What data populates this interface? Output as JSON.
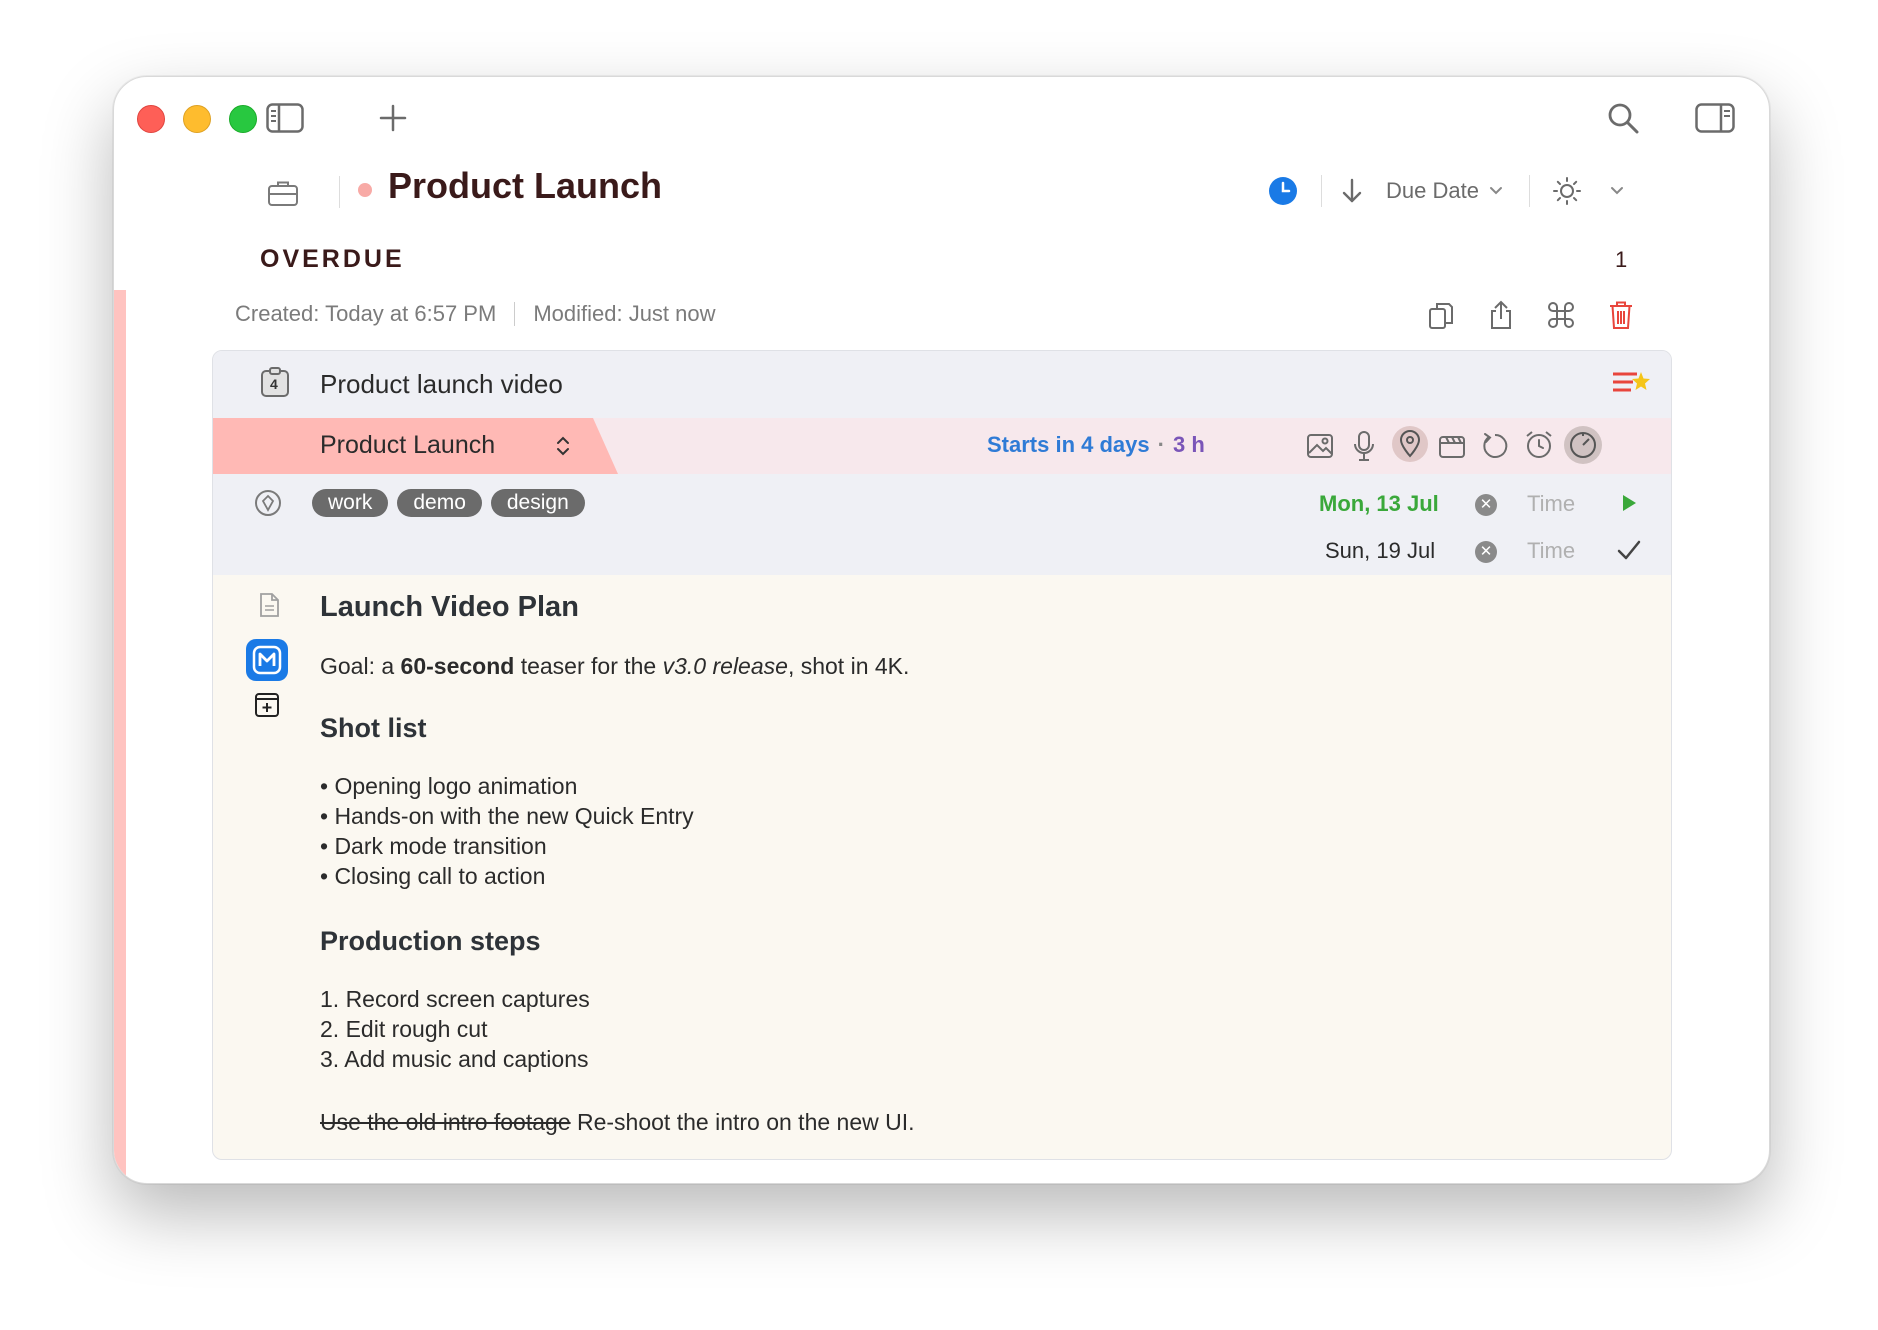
{
  "header": {
    "title": "Product Launch",
    "sort_label": "Due Date"
  },
  "section": {
    "title": "OVERDUE",
    "count": "1"
  },
  "meta": {
    "created": "Created: Today at 6:57 PM",
    "modified": "Modified: Just now"
  },
  "task": {
    "checklist_count": "4",
    "title": "Product launch video",
    "project": "Product Launch",
    "starts": "Starts in 4 days",
    "separator": "·",
    "duration": "3 h",
    "tags": [
      "work",
      "demo",
      "design"
    ],
    "start_date": "Mon, 13 Jul",
    "due_date": "Sun, 19 Jul",
    "time_placeholder": "Time"
  },
  "notes": {
    "heading": "Launch Video Plan",
    "goal_prefix": "Goal: a ",
    "goal_bold": "60-second",
    "goal_mid": " teaser for the ",
    "goal_italic": "v3.0 release",
    "goal_suffix": ", shot in 4K.",
    "shot_heading": "Shot list",
    "shots": [
      "• Opening logo animation",
      "• Hands-on with the new Quick Entry",
      "• Dark mode transition",
      "• Closing call to action"
    ],
    "steps_heading": "Production steps",
    "steps": [
      "1. Record screen captures",
      "2. Edit rough cut",
      "3. Add music and captions"
    ],
    "strike_text": "Use the old intro footage",
    "final_text": " Re-shoot the intro on the new UI."
  },
  "colors": {
    "accent_red": "#fe5f57",
    "project_pill": "#ffb9b5",
    "starts_blue": "#2f7bd6",
    "duration_purple": "#7a55b8",
    "start_green": "#3aa83a",
    "clock_blue": "#1a7ae6"
  },
  "icons": {
    "sidebar": "sidebar-icon",
    "add": "plus-icon",
    "search": "search-icon",
    "inspector": "inspector-icon",
    "folder": "briefcase-icon",
    "clock": "clock-icon",
    "sort": "arrow-down-icon",
    "theme": "sun-icon",
    "copy": "copy-icon",
    "share": "share-icon",
    "command": "command-icon",
    "trash": "trash-icon"
  }
}
